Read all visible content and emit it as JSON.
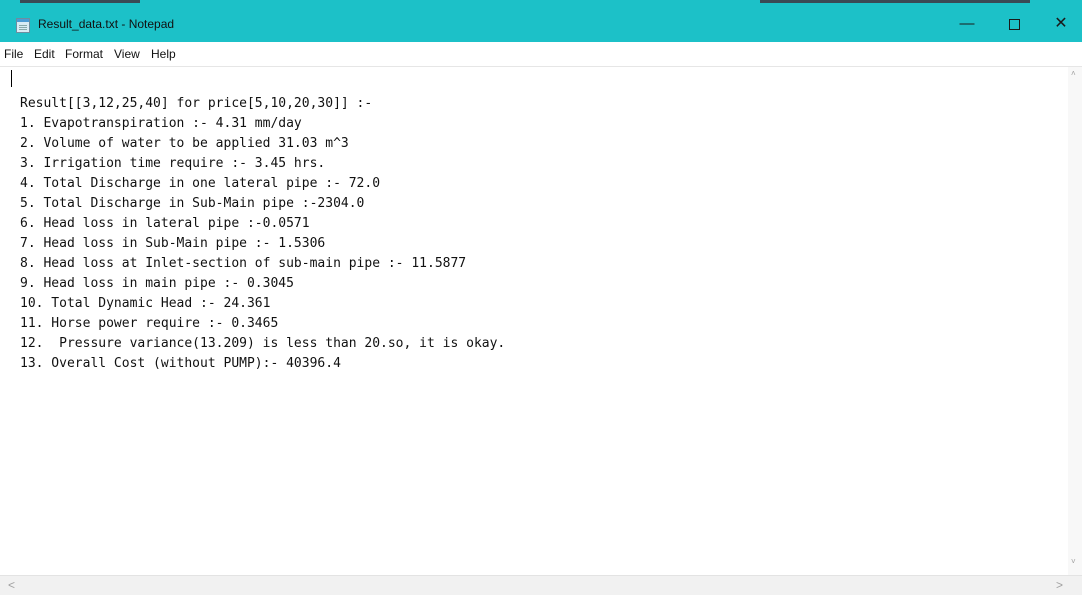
{
  "window": {
    "title": "Result_data.txt - Notepad",
    "icon": "notepad-icon",
    "titlebar_color": "#1cc1c8",
    "controls": {
      "minimize": "—",
      "close": "✕"
    }
  },
  "menu": {
    "items": [
      "File",
      "Edit",
      "Format",
      "View",
      "Help"
    ]
  },
  "document": {
    "lines": [
      "Result[[3,12,25,40] for price[5,10,20,30]] :-",
      "1. Evapotranspiration :- 4.31 mm/day",
      "2. Volume of water to be applied 31.03 m^3",
      "3. Irrigation time require :- 3.45 hrs.",
      "4. Total Discharge in one lateral pipe :- 72.0",
      "5. Total Discharge in Sub-Main pipe :-2304.0",
      "6. Head loss in lateral pipe :-0.0571",
      "7. Head loss in Sub-Main pipe :- 1.5306",
      "8. Head loss at Inlet-section of sub-main pipe :- 11.5877",
      "9. Head loss in main pipe :- 0.3045",
      "10. Total Dynamic Head :- 24.361",
      "11. Horse power require :- 0.3465",
      "12.  Pressure variance(13.209) is less than 20.so, it is okay.",
      "13. Overall Cost (without PUMP):- 40396.4"
    ]
  },
  "scrollbars": {
    "up_arrow": "˄",
    "down_arrow": "˅",
    "left_arrow": "<",
    "right_arrow": ">"
  }
}
